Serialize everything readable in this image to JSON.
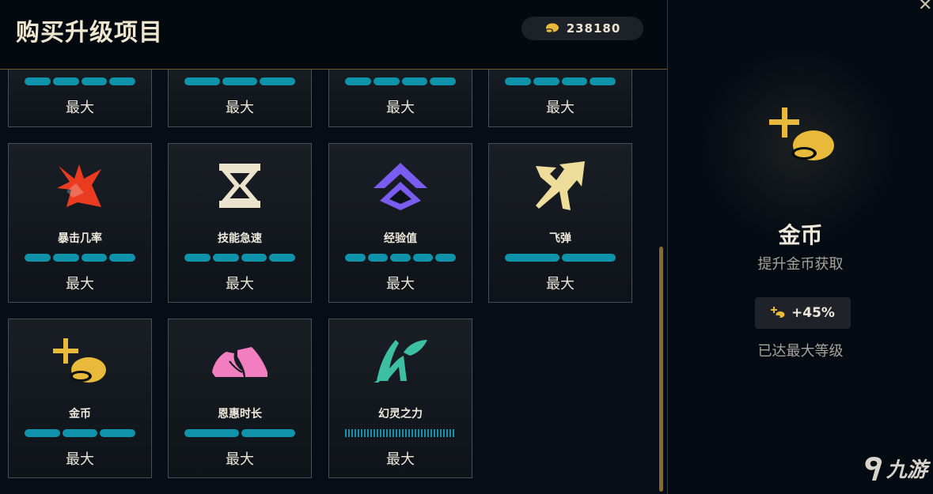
{
  "header": {
    "title": "购买升级项目",
    "coins": "238180"
  },
  "colors": {
    "accent_gold": "#e8b93a",
    "bar_teal": "#0e93ab",
    "panel_bg": "#070d16"
  },
  "top_row": [
    {
      "max_label": "最大"
    },
    {
      "max_label": "最大"
    },
    {
      "max_label": "最大"
    },
    {
      "max_label": "最大"
    }
  ],
  "cards": [
    {
      "name": "暴击几率",
      "icon": "crit-burst-icon",
      "max_label": "最大",
      "progress": 1.0
    },
    {
      "name": "技能急速",
      "icon": "hourglass-icon",
      "max_label": "最大",
      "progress": 1.0
    },
    {
      "name": "经验值",
      "icon": "double-chevron-up-icon",
      "max_label": "最大",
      "progress": 1.0
    },
    {
      "name": "飞弹",
      "icon": "arrow-arrow-icon",
      "max_label": "最大",
      "progress": 1.0
    },
    {
      "name": "金币",
      "icon": "plus-coin-icon",
      "max_label": "最大",
      "progress": 1.0
    },
    {
      "name": "恩惠时长",
      "icon": "pink-boots-icon",
      "max_label": "最大",
      "progress": 1.0
    },
    {
      "name": "幻灵之力",
      "icon": "teal-spirit-icon",
      "max_label": "最大",
      "progress": 1.0
    }
  ],
  "detail": {
    "icon": "plus-coin-icon",
    "title": "金币",
    "description": "提升金币获取",
    "bonus": "+45%",
    "status": "已达最大等级",
    "close_icon": "close-icon"
  },
  "watermark": {
    "text": "九游",
    "icon": "jiuyou-logo-icon"
  }
}
